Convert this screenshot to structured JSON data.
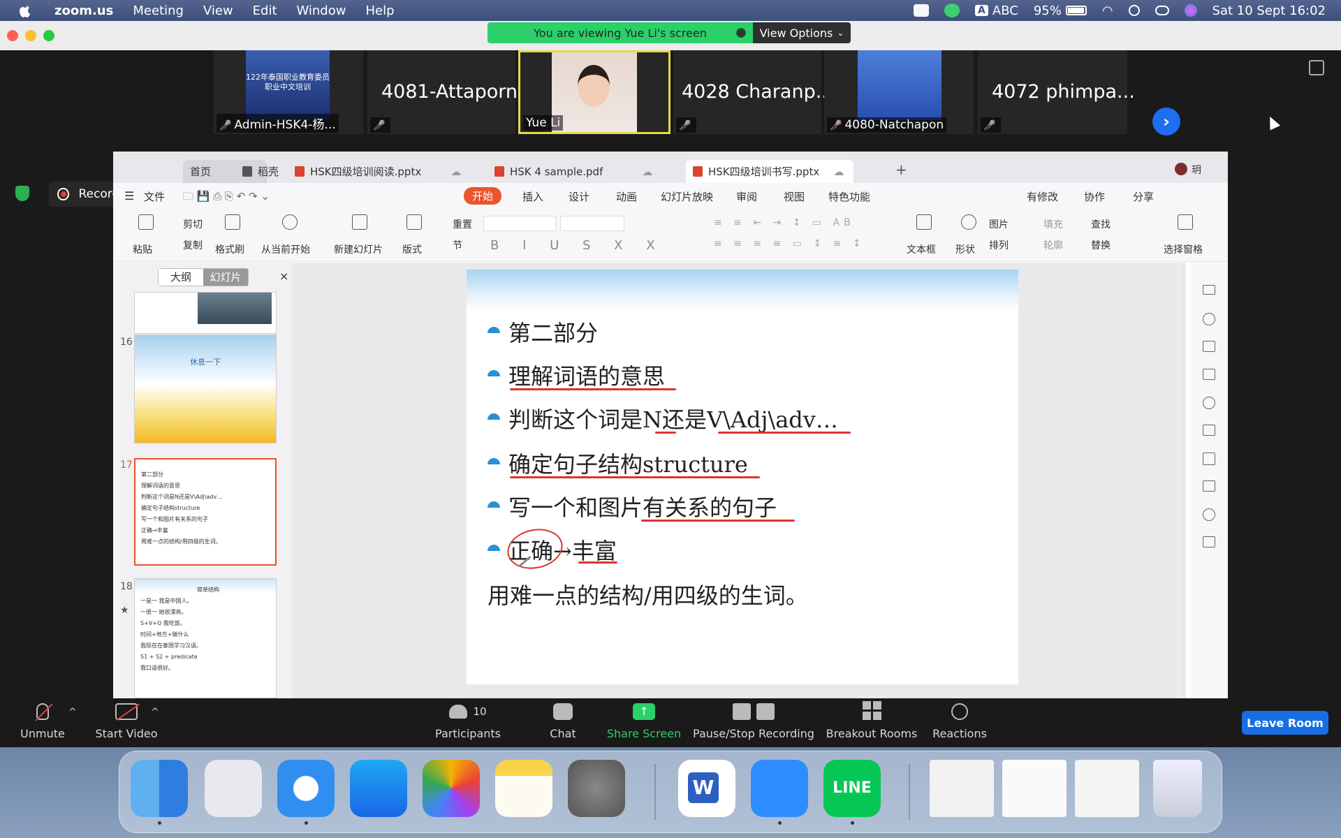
{
  "menubar": {
    "app": "zoom.us",
    "items": [
      "Meeting",
      "View",
      "Edit",
      "Window",
      "Help"
    ],
    "input_source": "ABC",
    "battery": "95%",
    "datetime": "Sat 10 Sept  16:02"
  },
  "zoom": {
    "viewing_banner": "You are viewing Yue Li's screen",
    "view_options": "View Options",
    "recording_label": "Recording...",
    "participants": [
      {
        "name": "Admin-HSK4-杨...",
        "type": "image",
        "poster_text": "122年泰国职业教育委员\n职业中文培训"
      },
      {
        "name": "4081-Attaporn",
        "type": "name"
      },
      {
        "name": "Yue Li",
        "type": "video"
      },
      {
        "name": "4028 Charanp...",
        "type": "name"
      },
      {
        "name": "4080-Natchapon",
        "type": "video"
      },
      {
        "name": "4072 phimpa...",
        "type": "name"
      }
    ],
    "toolbar": {
      "unmute": "Unmute",
      "start_video": "Start Video",
      "participants": "Participants",
      "participants_count": "10",
      "chat": "Chat",
      "share_screen": "Share Screen",
      "pause_stop_recording": "Pause/Stop Recording",
      "breakout_rooms": "Breakout Rooms",
      "reactions": "Reactions",
      "leave": "Leave Room"
    }
  },
  "wps": {
    "tabs": [
      {
        "label": "首页"
      },
      {
        "label": "稻壳"
      },
      {
        "label": "HSK四级培训阅读.pptx"
      },
      {
        "label": "HSK 4 sample.pdf"
      },
      {
        "label": "HSK四级培训书写.pptx",
        "active": true
      }
    ],
    "user_initial": "玥",
    "menu": {
      "file": "文件",
      "start": "开始",
      "items": [
        "插入",
        "设计",
        "动画",
        "幻灯片放映",
        "审阅",
        "视图",
        "特色功能"
      ],
      "modified": "有修改",
      "collab": "协作",
      "share": "分享"
    },
    "ribbon": {
      "paste": "粘贴",
      "cut": "剪切",
      "copy": "复制",
      "format_painter": "格式刷",
      "from_current": "从当前开始",
      "new_slide": "新建幻灯片",
      "layout": "版式",
      "reset": "重置",
      "section": "节",
      "textbox": "文本框",
      "shape": "形状",
      "picture": "图片",
      "arrange": "排列",
      "fill": "填充",
      "outline": "轮廓",
      "find": "查找",
      "replace": "替换",
      "select_pane": "选择窗格"
    },
    "panel": {
      "outline": "大纲",
      "slides": "幻灯片",
      "thumbs": [
        {
          "num": "16",
          "title": "休息一下"
        },
        {
          "num": "17",
          "lines": [
            "第二部分",
            "理解词语的意思",
            "判断这个词是N还是V\\Adj\\adv…",
            "确定句子结构structure",
            "写一个和图片有关系的句子",
            "正确→丰富",
            "用难一点的结构/用四级的生词。"
          ]
        },
        {
          "num": "18",
          "title": "简单结构",
          "lines": [
            "一是一 我是中国人。",
            "一很一 她很漂亮。",
            "S+V+O 我吃饭。",
            "时间+地方+做什么",
            "我现在在泰国学习汉语。",
            "S1 + S2 + predicate",
            "我口语很好。"
          ]
        }
      ]
    },
    "slide": {
      "bullets": [
        "第二部分",
        "理解词语的意思",
        "判断这个词是N还是V\\Adj\\adv…",
        "确定句子结构structure",
        "写一个和图片有关系的句子",
        "正确→丰富"
      ],
      "footer_line": "用难一点的结构/用四级的生词。"
    }
  },
  "colors": {
    "zoom_green": "#2bd06a",
    "zoom_blue": "#1670e4",
    "wps_accent": "#e9552f",
    "underline_red": "#d9352f"
  }
}
